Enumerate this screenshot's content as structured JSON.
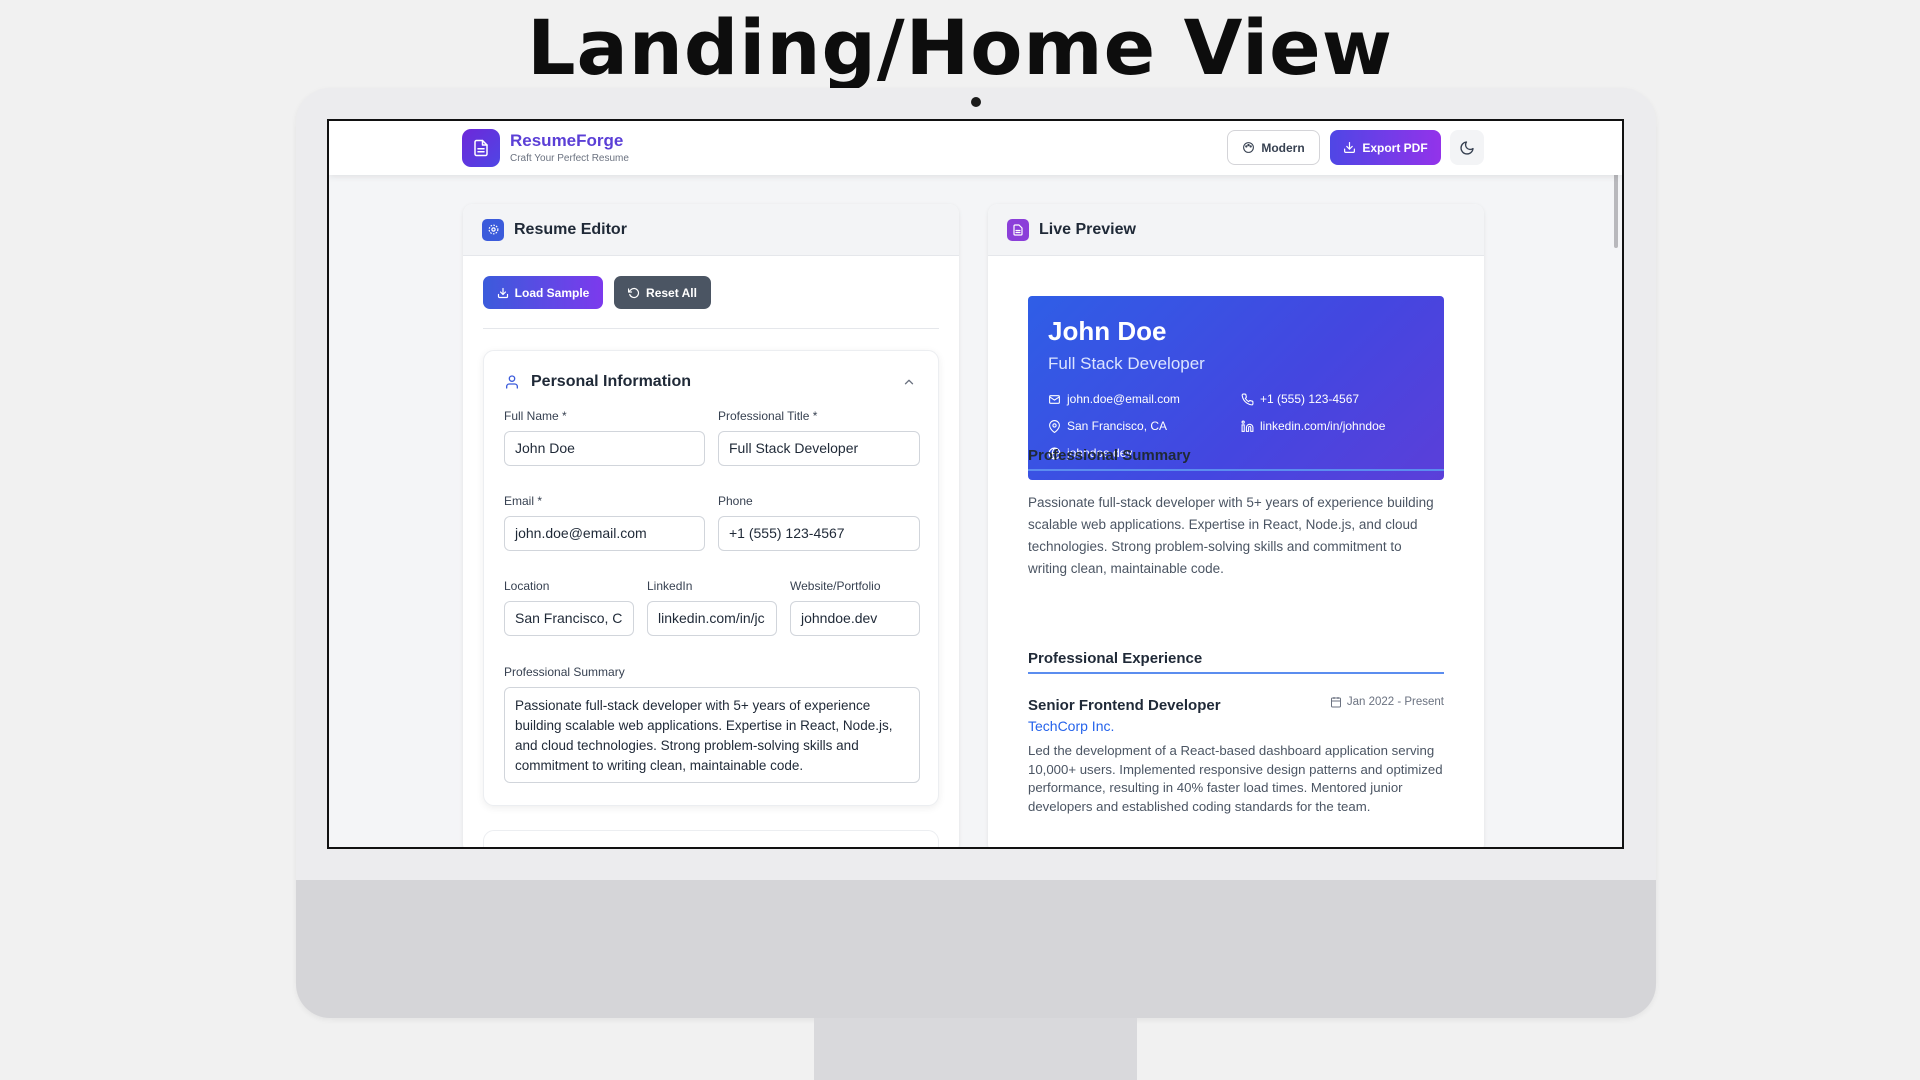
{
  "page_heading": "Landing/Home View",
  "app": {
    "brand": "ResumeForge",
    "tagline": "Craft Your Perfect Resume",
    "template_button": "Modern",
    "export_button": "Export PDF",
    "theme_icon": "moon-icon",
    "accent": "#5b3fd6"
  },
  "editor": {
    "title": "Resume Editor",
    "load_sample": "Load Sample",
    "reset_all": "Reset All",
    "personal": {
      "title": "Personal Information",
      "full_name": {
        "label": "Full Name *",
        "value": "John Doe"
      },
      "professional_title": {
        "label": "Professional Title *",
        "value": "Full Stack Developer"
      },
      "email": {
        "label": "Email *",
        "value": "john.doe@email.com"
      },
      "phone": {
        "label": "Phone",
        "value": "+1 (555) 123-4567"
      },
      "location": {
        "label": "Location",
        "value": "San Francisco, C"
      },
      "linkedin": {
        "label": "LinkedIn",
        "value": "linkedin.com/in/jc"
      },
      "website": {
        "label": "Website/Portfolio",
        "value": "johndoe.dev"
      },
      "summary": {
        "label": "Professional Summary",
        "value": "Passionate full-stack developer with 5+ years of experience building scalable web applications. Expertise in React, Node.js, and cloud technologies. Strong problem-solving skills and commitment to writing clean, maintainable code."
      }
    }
  },
  "preview": {
    "title": "Live Preview",
    "name": "John Doe",
    "job_title": "Full Stack Developer",
    "email": "john.doe@email.com",
    "phone": "+1 (555) 123-4567",
    "location": "San Francisco, CA",
    "linkedin": "linkedin.com/in/johndoe",
    "website": "johndoe.dev",
    "summary_heading": "Professional Summary",
    "summary": "Passionate full-stack developer with 5+ years of experience building scalable web applications. Expertise in React, Node.js, and cloud technologies. Strong problem-solving skills and commitment to writing clean, maintainable code.",
    "experience_heading": "Professional Experience",
    "experience": [
      {
        "role": "Senior Frontend Developer",
        "dates": "Jan 2022 - Present",
        "company": "TechCorp Inc.",
        "description": "Led the development of a React-based dashboard application serving 10,000+ users. Implemented responsive design patterns and optimized performance, resulting in 40% faster load times. Mentored junior developers and established coding standards for the team."
      }
    ]
  }
}
